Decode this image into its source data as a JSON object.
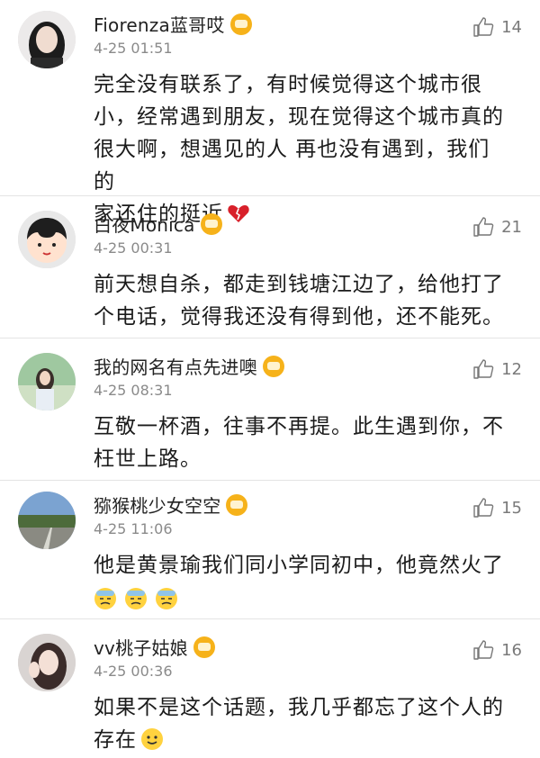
{
  "comments": [
    {
      "username": "Fiorenza蓝哥哎",
      "time": "4-25 01:51",
      "likes": "14",
      "lines": [
        "完全没有联系了，有时候觉得这个城市很",
        "小，经常遇到朋友，现在觉得这个城市真的",
        "很大啊，想遇见的人 再也没有遇到，我们的",
        "家还住的挺近"
      ]
    },
    {
      "username": "白夜Monica",
      "time": "4-25 00:31",
      "likes": "21",
      "lines": [
        "前天想自杀，都走到钱塘江边了，给他打了",
        "个电话，觉得我还没有得到他，还不能死。"
      ]
    },
    {
      "username": "我的网名有点先进噢",
      "time": "4-25 08:31",
      "likes": "12",
      "lines": [
        "互敬一杯酒，往事不再提。此生遇到你，不",
        "枉世上路。"
      ]
    },
    {
      "username": "猕猴桃少女空空",
      "time": "4-25 11:06",
      "likes": "15",
      "lines": [
        "他是黄景瑜我们同小学同初中，他竟然火了"
      ]
    },
    {
      "username": "vv桃子姑娘",
      "time": "4-25 00:36",
      "likes": "16",
      "lines": [
        "如果不是这个话题，我几乎都忘了这个人的",
        "存在"
      ]
    }
  ],
  "icons": {
    "like": "thumbs-up-icon",
    "vip": "vip-crown-icon",
    "broken_heart": "broken-heart-icon",
    "sweat": "sweat-face-icon",
    "smile": "smile-face-icon"
  },
  "colors": {
    "vip": "#f6b21a",
    "broken_heart": "#d8202a",
    "emoji": "#ffd23f",
    "sweat": "#8fc4e8"
  }
}
